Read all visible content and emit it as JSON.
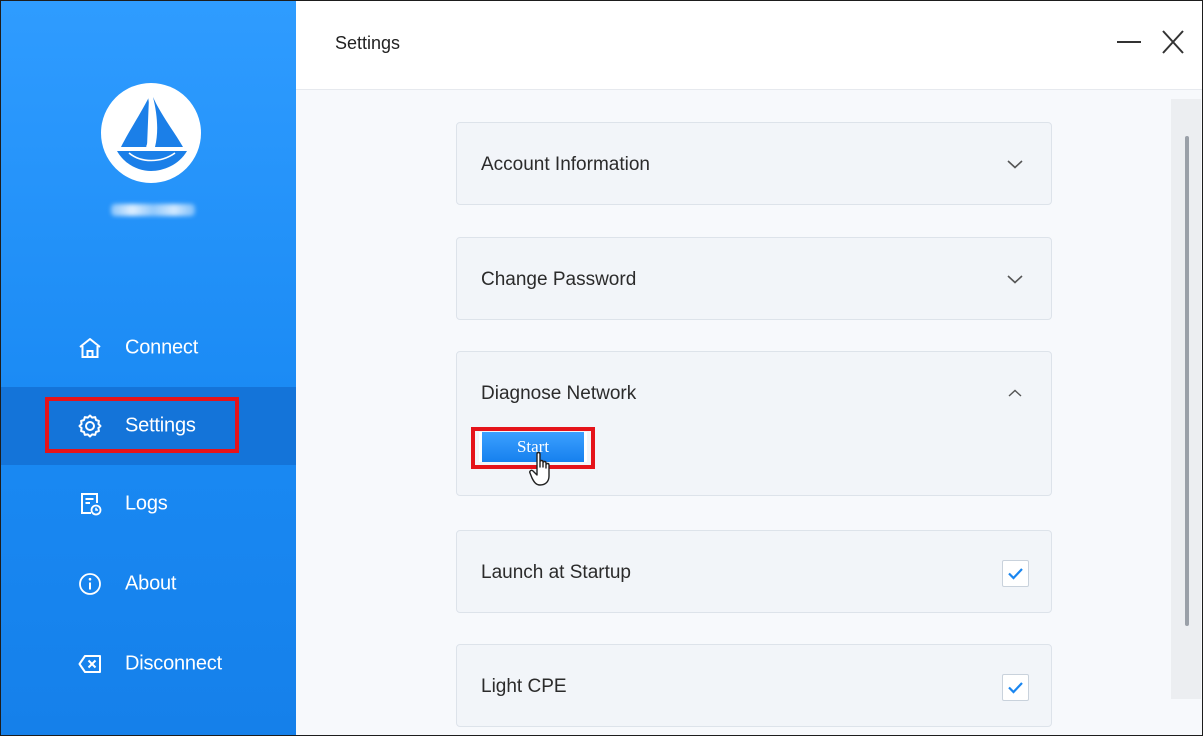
{
  "sidebar": {
    "nav": [
      {
        "label": "Connect",
        "icon": "home-icon"
      },
      {
        "label": "Settings",
        "icon": "gear-icon",
        "active": true
      },
      {
        "label": "Logs",
        "icon": "log-document-icon"
      },
      {
        "label": "About",
        "icon": "info-icon"
      },
      {
        "label": "Disconnect",
        "icon": "backspace-x-icon"
      }
    ]
  },
  "header": {
    "title": "Settings"
  },
  "settings": {
    "account_information": "Account Information",
    "change_password": "Change Password",
    "diagnose_network": "Diagnose Network",
    "start_button": "Start",
    "launch_at_startup": "Launch at Startup",
    "launch_at_startup_checked": true,
    "light_cpe": "Light CPE",
    "light_cpe_checked": true
  },
  "colors": {
    "sidebar_blue": "#1a8af4",
    "active_item": "#1474d9",
    "highlight_red": "#e5131a",
    "check_blue": "#1a86f0"
  }
}
